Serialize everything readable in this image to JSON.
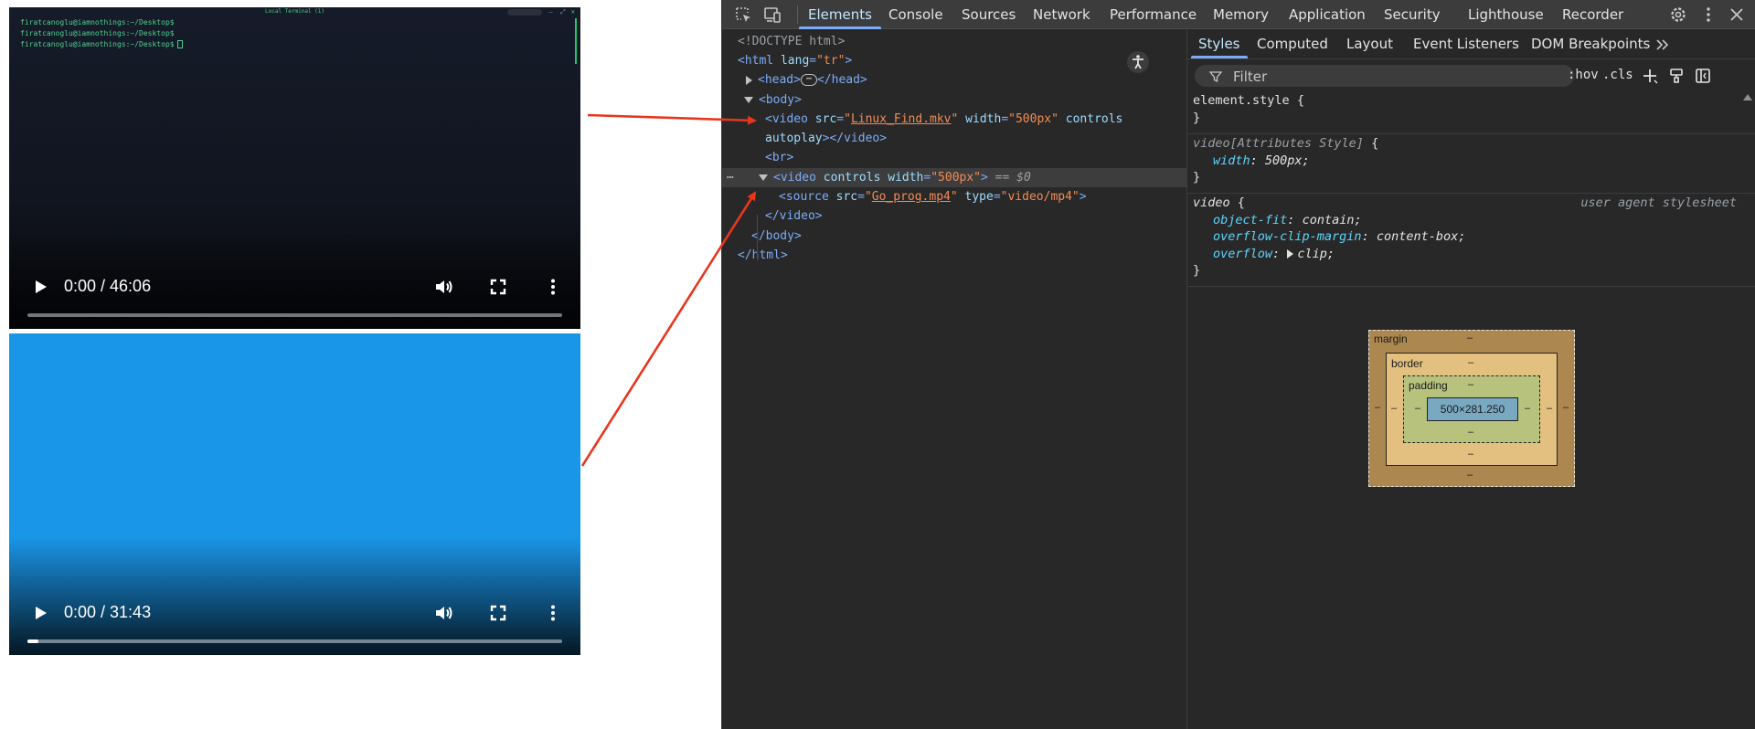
{
  "terminal": {
    "title": "Local Terminal (1)",
    "lines": [
      "firatcanoglu@iamnothings:~/Desktop$",
      "firatcanoglu@iamnothings:~/Desktop$",
      "firatcanoglu@iamnothings:~/Desktop$"
    ]
  },
  "videos": [
    {
      "time": "0:00 / 46:06",
      "progress_fraction": 0.0
    },
    {
      "time": "0:00 / 31:43",
      "progress_fraction": 0.02
    }
  ],
  "devtools": {
    "tabs": [
      "Elements",
      "Console",
      "Sources",
      "Network",
      "Performance",
      "Memory",
      "Application",
      "Security",
      "Lighthouse",
      "Recorder"
    ],
    "active_tab": "Elements",
    "icons": [
      "inspect-element-icon",
      "device-toolbar-icon",
      "settings-gear-icon",
      "more-options-icon",
      "close-icon"
    ],
    "dom": {
      "doctype": "<!DOCTYPE html>",
      "html_open": "<html",
      "html_attr": "lang",
      "html_val": "\"tr\"",
      "html_close": ">",
      "head_open": "<head>",
      "head_ellipsis": "⋯",
      "head_close": "</head>",
      "body_open": "<body>",
      "video1_open": "<video",
      "video1_src_attr": "src",
      "video1_src_val": "Linux_Find.mkv",
      "video1_width_attr": "width",
      "video1_width_val": "\"500px\"",
      "video1_controls": "controls",
      "video1_autoplay": "autoplay",
      "video1_close": "></video>",
      "br": "<br>",
      "video2_open": "<video",
      "video2_controls": "controls",
      "video2_width_attr": "width",
      "video2_width_val": "\"500px\"",
      "video2_gt": ">",
      "video2_eq": "== $0",
      "source_open": "<source",
      "source_src_attr": "src",
      "source_src_val": "Go_prog.mp4",
      "source_type_attr": "type",
      "source_type_val": "\"video/mp4\"",
      "source_close": ">",
      "video2_close": "</video>",
      "body_close": "</body>",
      "html_end": "</html>",
      "quote": "\"",
      "eq": "=",
      "dots": "⋯"
    },
    "styles_tabs": [
      "Styles",
      "Computed",
      "Layout",
      "Event Listeners",
      "DOM Breakpoints"
    ],
    "styles_active": "Styles",
    "filter_placeholder": "Filter",
    "filter_buttons": [
      ":hov",
      ".cls"
    ],
    "rules": {
      "element_style": "element.style",
      "attr_style_selector": "video[Attributes Style]",
      "width_prop": "width",
      "width_val": "500px;",
      "ua_selector": "video",
      "ua_source": "user agent stylesheet",
      "object_fit_prop": "object-fit",
      "object_fit_val": "contain;",
      "clip_margin_prop": "overflow-clip-margin",
      "clip_margin_val": "content-box;",
      "overflow_prop": "overflow",
      "overflow_val": "clip;",
      "open_brace": "{",
      "close_brace": "}",
      "colon": ":"
    },
    "box_model": {
      "margin_label": "margin",
      "border_label": "border",
      "padding_label": "padding",
      "content_size": "500×281.250",
      "dash": "–"
    }
  },
  "colors": {
    "annotation_arrow": "#e8361d",
    "devtools_bg": "#282828",
    "active_tab": "#7cacf8",
    "video2_bg": "#1a96e8"
  }
}
